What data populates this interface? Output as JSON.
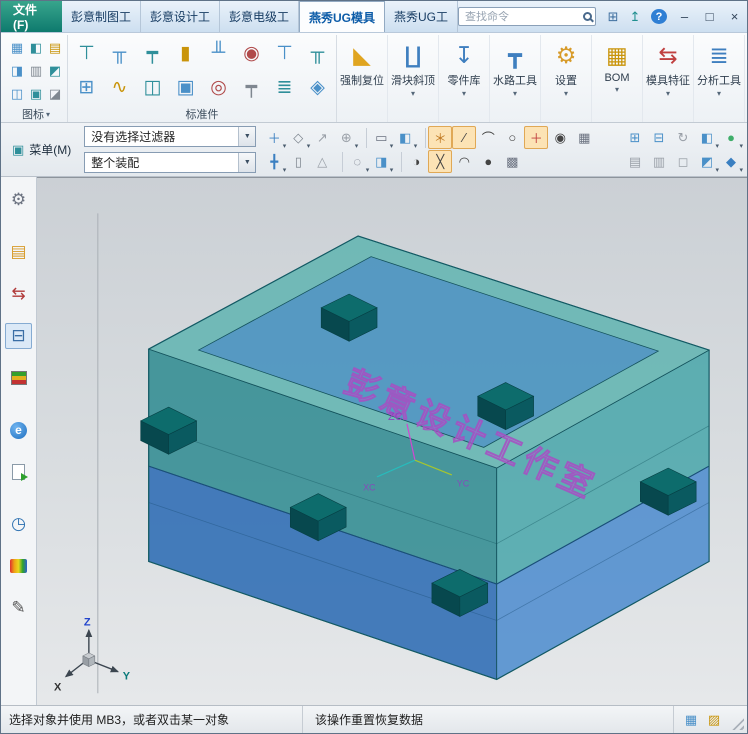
{
  "titlebar": {
    "file_button": "文件(F)",
    "tabs": [
      {
        "name": "tab-pengyi-drafting",
        "label": "彭意制图工"
      },
      {
        "name": "tab-pengyi-design",
        "label": "彭意设计工"
      },
      {
        "name": "tab-pengyi-electrode",
        "label": "彭意电级工"
      },
      {
        "name": "tab-yanxiu-mold",
        "label": "燕秀UG模具",
        "active": true
      },
      {
        "name": "tab-yanxiu-tools",
        "label": "燕秀UG工具"
      }
    ],
    "search_placeholder": "查找命令",
    "utility_icons": [
      {
        "name": "window-gallery-icon",
        "glyph": "⊞",
        "color": "#3f6f9f"
      },
      {
        "name": "sync-icon",
        "glyph": "↥",
        "color": "#1f8f8f"
      }
    ],
    "help_label": "?",
    "window_controls": [
      {
        "name": "minimize-button",
        "glyph": "–"
      },
      {
        "name": "maximize-button",
        "glyph": "□"
      },
      {
        "name": "close-button",
        "glyph": "×"
      }
    ]
  },
  "ribbon": {
    "group1": {
      "label": "图标",
      "icons": [
        {
          "name": "icon-grid-1",
          "glyph": "▦",
          "color": "#4a90c8"
        },
        {
          "name": "icon-grid-2",
          "glyph": "◧",
          "color": "#2f8f9a"
        },
        {
          "name": "icon-grid-3",
          "glyph": "▤",
          "color": "#c9940a"
        },
        {
          "name": "icon-grid-4",
          "glyph": "◨",
          "color": "#4a90c8"
        },
        {
          "name": "icon-grid-5",
          "glyph": "▥",
          "color": "#7f8790"
        },
        {
          "name": "icon-grid-6",
          "glyph": "◩",
          "color": "#2f8f9a"
        },
        {
          "name": "icon-grid-7",
          "glyph": "◫",
          "color": "#4a90c8"
        },
        {
          "name": "icon-grid-8",
          "glyph": "▣",
          "color": "#2f8f9a"
        },
        {
          "name": "icon-grid-9",
          "glyph": "◪",
          "color": "#7f8790"
        }
      ]
    },
    "group2": {
      "label": "标准件",
      "row1": [
        {
          "name": "ejector-pin-icon",
          "glyph": "⊤",
          "color": "#2f8f9a"
        },
        {
          "name": "sleeve-pin-icon",
          "glyph": "╥",
          "color": "#4a90c8"
        },
        {
          "name": "guide-pin-icon",
          "glyph": "┯",
          "color": "#2f8f9a"
        },
        {
          "name": "insert-block-icon",
          "glyph": "▮",
          "color": "#c9940a"
        },
        {
          "name": "support-pin-icon",
          "glyph": "╨",
          "color": "#4a90c8"
        },
        {
          "name": "locating-ring-icon",
          "glyph": "◉",
          "color": "#b04a4a"
        },
        {
          "name": "straight-pin-icon",
          "glyph": "⊤",
          "color": "#4a90c8"
        },
        {
          "name": "shoulder-pin-icon",
          "glyph": "╥",
          "color": "#2f8f9a"
        }
      ],
      "row2": [
        {
          "name": "plate-icon",
          "glyph": "⊞",
          "color": "#4a90c8"
        },
        {
          "name": "spring-icon",
          "glyph": "∿",
          "color": "#c9940a"
        },
        {
          "name": "block-icon",
          "glyph": "◫",
          "color": "#2f8f9a"
        },
        {
          "name": "pad-icon",
          "glyph": "▣",
          "color": "#4a90c8"
        },
        {
          "name": "ring-icon",
          "glyph": "◎",
          "color": "#b04a4a"
        },
        {
          "name": "pillar-icon",
          "glyph": "┯",
          "color": "#7f8790"
        },
        {
          "name": "rail-icon",
          "glyph": "≣",
          "color": "#2f8f9a"
        },
        {
          "name": "gate-icon",
          "glyph": "◈",
          "color": "#4a90c8"
        }
      ]
    },
    "big_buttons": [
      {
        "name": "force-reset-button",
        "label": "强制复位",
        "glyph": "◣",
        "color": "#e0a520"
      },
      {
        "name": "slider-lifter-button",
        "label": "滑块斜顶",
        "glyph": "∐",
        "color": "#3f7fbf",
        "caret": true
      },
      {
        "name": "parts-library-button",
        "label": "零件库",
        "glyph": "↧",
        "color": "#3f7fbf",
        "caret": true
      },
      {
        "name": "waterway-tools-button",
        "label": "水路工具",
        "glyph": "┳",
        "color": "#3f7fbf",
        "caret": true
      },
      {
        "name": "settings-button",
        "label": "设置",
        "glyph": "⚙",
        "color": "#d79b2a",
        "caret": true
      },
      {
        "name": "bom-button",
        "label": "BOM",
        "glyph": "▦",
        "color": "#c9940a",
        "caret": true
      },
      {
        "name": "mold-features-button",
        "label": "模具特征",
        "glyph": "⇆",
        "color": "#c04040",
        "caret": true
      },
      {
        "name": "analysis-tools-button",
        "label": "分析工具",
        "glyph": "≣",
        "color": "#3f7fbf",
        "caret": true
      }
    ]
  },
  "toolbar": {
    "menu_label": "菜单(M)",
    "menu_glyph": "▣",
    "selection_filter_value": "没有选择过滤器",
    "scope_value": "整个装配",
    "row_top": [
      {
        "name": "snap-point-tool-icon",
        "glyph": "＋",
        "color": "#3a7fc1",
        "caret": true
      },
      {
        "name": "datum-plane-icon",
        "glyph": "◇",
        "color": "#7f8790",
        "caret": true
      },
      {
        "name": "move-face-icon",
        "glyph": "↗",
        "color": "#9aa0a8"
      },
      {
        "name": "rotate-view-icon",
        "glyph": "⊕",
        "color": "#9aa0a8",
        "caret": true
      },
      {
        "sep": true
      },
      {
        "name": "rectangle-select-icon",
        "glyph": "▭",
        "color": "#6b7280",
        "caret": true
      },
      {
        "name": "shaded-view-icon",
        "glyph": "◧",
        "color": "#4a90c8",
        "caret": true
      },
      {
        "sep": true
      },
      {
        "name": "snap-enable-icon",
        "glyph": "＊",
        "color": "#c07820",
        "active": true
      },
      {
        "name": "snap-endpoint-icon",
        "glyph": "∕",
        "color": "#444444",
        "active": true
      },
      {
        "name": "snap-arc-icon",
        "glyph": "⌒",
        "color": "#444444"
      },
      {
        "name": "snap-circle-icon",
        "glyph": "○",
        "color": "#444444"
      },
      {
        "name": "snap-point-icon",
        "glyph": "＋",
        "color": "#c04040",
        "active": true
      },
      {
        "name": "snap-center-icon",
        "glyph": "◉",
        "color": "#444444"
      },
      {
        "name": "grid-snap-icon",
        "glyph": "▦",
        "color": "#6b7280"
      }
    ],
    "row_bottom": [
      {
        "name": "wcs-orient-icon",
        "glyph": "╋",
        "color": "#3a7fc1",
        "caret": true
      },
      {
        "name": "plane-tool-icon",
        "glyph": "▯",
        "color": "#7f8790"
      },
      {
        "name": "scale-view-icon",
        "glyph": "△",
        "color": "#9aa0a8"
      },
      {
        "sep": true
      },
      {
        "name": "lasso-select-icon",
        "glyph": "◌",
        "color": "#6b7280",
        "caret": true
      },
      {
        "name": "render-style-icon",
        "glyph": "◨",
        "color": "#4a90c8",
        "caret": true
      },
      {
        "sep": true
      },
      {
        "name": "snap-quadrant-icon",
        "glyph": "◑",
        "color": "#444444"
      },
      {
        "name": "snap-intersection-icon",
        "glyph": "╳",
        "color": "#444444",
        "active": true
      },
      {
        "name": "snap-tangent-icon",
        "glyph": "◠",
        "color": "#444444"
      },
      {
        "name": "snap-node-icon",
        "glyph": "●",
        "color": "#444444"
      },
      {
        "name": "snap-grid-icon",
        "glyph": "▩",
        "color": "#6b7280"
      }
    ],
    "right_top": [
      {
        "name": "fit-window-icon",
        "glyph": "⊞",
        "color": "#4a90c8"
      },
      {
        "name": "new-window-icon",
        "glyph": "⊟",
        "color": "#4a90c8"
      },
      {
        "name": "refresh-icon",
        "glyph": "↻",
        "color": "#9aa0a8"
      },
      {
        "name": "display-cube-icon",
        "glyph": "◧",
        "color": "#4a90c8",
        "caret": true
      },
      {
        "name": "material-sphere-icon",
        "glyph": "●",
        "color": "#3fae6a",
        "caret": true
      }
    ],
    "right_bottom": [
      {
        "name": "pane-toggle-icon",
        "glyph": "▤",
        "color": "#9aa0a8"
      },
      {
        "name": "layout-icon",
        "glyph": "▥",
        "color": "#9aa0a8"
      },
      {
        "name": "wireframe-icon",
        "glyph": "◻",
        "color": "#9aa0a8"
      },
      {
        "name": "render-mode-icon",
        "glyph": "◩",
        "color": "#4a90c8",
        "caret": true
      },
      {
        "name": "gem-display-icon",
        "glyph": "◆",
        "color": "#3a7fc1",
        "caret": true
      }
    ]
  },
  "resource_bar": {
    "icons": [
      {
        "name": "roles-gear-icon",
        "glyph": "⚙",
        "color": "#6b7280"
      },
      {
        "name": "assembly-navigator-icon",
        "glyph": "▤",
        "color": "#d79b2a",
        "gap": true
      },
      {
        "name": "constraint-navigator-icon",
        "glyph": "⇆",
        "color": "#b03a3a"
      },
      {
        "name": "part-navigator-icon",
        "glyph": "⊟",
        "color": "#3a6ea5",
        "active": true
      },
      {
        "name": "layers-icon",
        "cls": "sw-layers"
      },
      {
        "name": "web-browser-icon",
        "cls": "sw-web",
        "glyph": "e",
        "gap": true
      },
      {
        "name": "document-export-icon",
        "cls": "sw-doc"
      },
      {
        "name": "history-icon",
        "glyph": "◷",
        "color": "#2a6fb0",
        "gap": true
      },
      {
        "name": "palette-icon",
        "cls": "sw-rainbow"
      },
      {
        "name": "pen-icon",
        "glyph": "✎",
        "color": "#555555"
      }
    ]
  },
  "viewport": {
    "watermark": "彭意设计工作室",
    "zc_label": "ZC",
    "xc_label": "XC",
    "yc_label": "YC",
    "axis_x": "X",
    "axis_y": "Y",
    "axis_z": "Z"
  },
  "colors": {
    "accent_teal": "#0e7a6e",
    "top_face": "#66b6b2",
    "cavity_face": "#4586c8",
    "upper_left_face": "#2e8a90",
    "upper_right_face": "#3fa3a6",
    "lower_left_face": "#2e6cb4",
    "lower_right_face": "#4687cd",
    "block_top": "#0d6c6c",
    "block_side_dark": "#07484e",
    "block_side": "#0a5a60",
    "watermark": "#b264cf",
    "snap_active_bg": "#fce3b5"
  },
  "statusbar": {
    "left": "选择对象并使用 MB3，或者双击某一对象",
    "center": "该操作重置恢复数据",
    "icons": [
      {
        "name": "clipboard-icon",
        "glyph": "▦",
        "color": "#4a90c8"
      },
      {
        "name": "panel-icon",
        "glyph": "▨",
        "color": "#c9940a"
      }
    ]
  }
}
